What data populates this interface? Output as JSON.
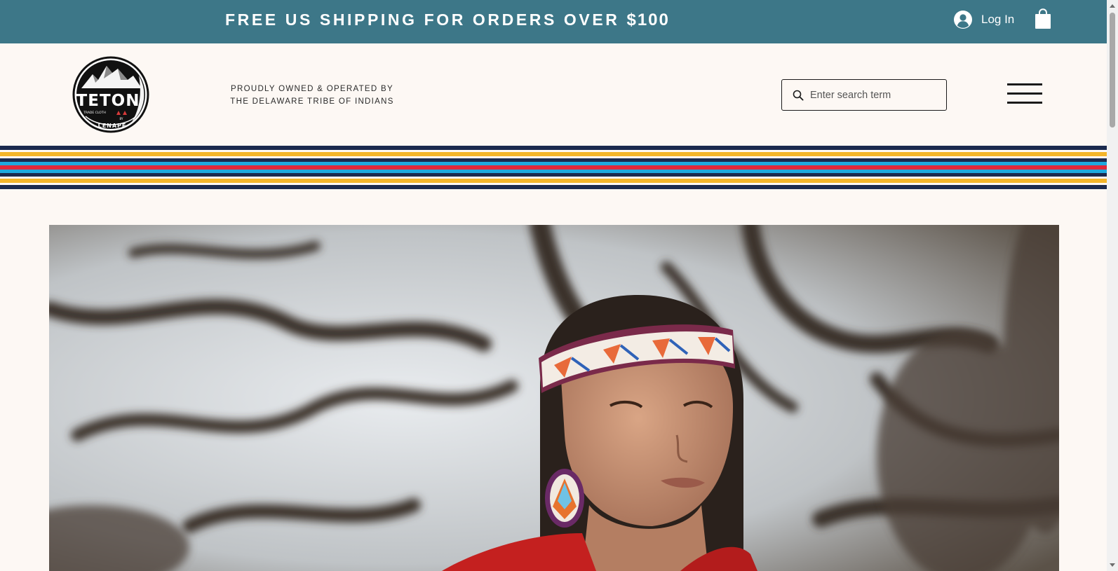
{
  "promo": {
    "text": "FREE US SHIPPING FOR ORDERS OVER ",
    "amount": "$100"
  },
  "account": {
    "login_label": "Log In",
    "avatar_icon": "user-avatar-icon",
    "cart_icon": "shopping-bag-icon"
  },
  "header": {
    "logo": {
      "main": "TETON",
      "sub": "TRADE CLOTH",
      "by": "BY",
      "brand": "LENAPE"
    },
    "tagline_line1": "PROUDLY OWNED & OPERATED BY",
    "tagline_line2": "THE DELAWARE TRIBE OF INDIANS",
    "search": {
      "placeholder": "Enter search term",
      "value": ""
    },
    "menu_icon": "hamburger-menu-icon"
  },
  "colors": {
    "promo_bg": "#3d7788",
    "page_bg": "#fdf8f4",
    "stripe_navy": "#1b2a4e",
    "stripe_yellow": "#f3b52a",
    "stripe_red": "#e0283a",
    "stripe_sky": "#1ea9de"
  },
  "hero": {
    "alt": "Woman wearing beaded headband and beaded earrings standing beneath trees"
  }
}
